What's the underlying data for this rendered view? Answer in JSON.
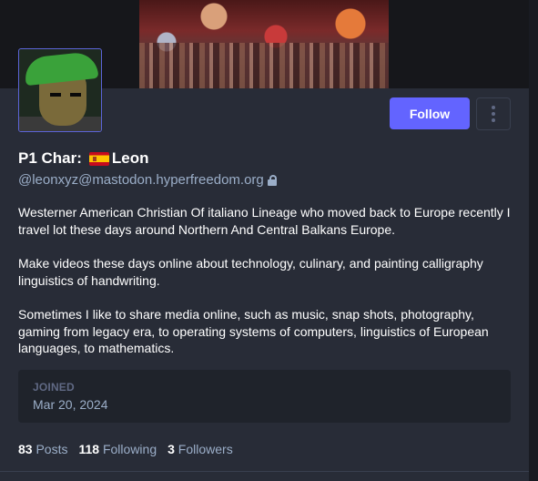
{
  "profile": {
    "display_name_prefix": "P1 Char:",
    "display_name": "Leon",
    "flag_icon": "spain-flag-icon",
    "handle": "@leonxyz@mastodon.hyperfreedom.org",
    "lock_icon": "lock-icon",
    "bio": [
      "Westerner American Christian Of italiano Lineage who moved back to Europe recently I travel lot these days around Northern And Central Balkans Europe.",
      "Make videos these days online about technology, culinary, and painting calligraphy linguistics of handwriting.",
      "Sometimes I like to share media online, such as music, snap shots, photography, gaming from legacy era, to operating systems of computers, linguistics of European languages, to mathematics."
    ]
  },
  "actions": {
    "follow_label": "Follow",
    "menu_icon": "vertical-ellipsis-icon"
  },
  "joined": {
    "label": "JOINED",
    "date": "Mar 20, 2024"
  },
  "stats": {
    "posts_count": "83",
    "posts_label": "Posts",
    "following_count": "118",
    "following_label": "Following",
    "followers_count": "3",
    "followers_label": "Followers"
  },
  "colors": {
    "accent": "#6364ff",
    "background": "#282c37",
    "muted_text": "#9baec8"
  }
}
